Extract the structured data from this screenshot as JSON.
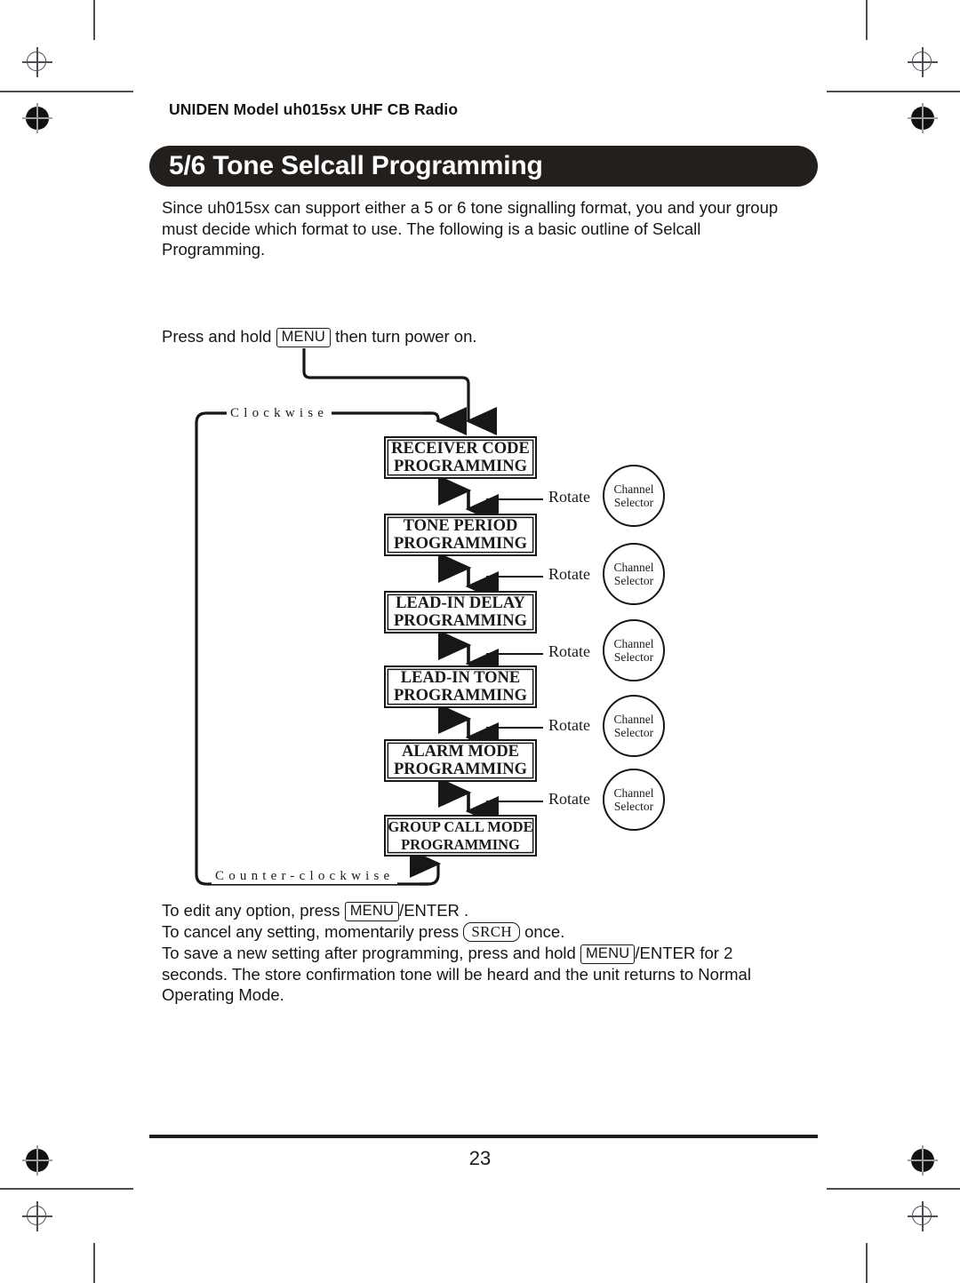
{
  "header": {
    "running_head": "UNIDEN Model uh015sx UHF CB Radio",
    "title": "5/6 Tone Selcall Programming"
  },
  "intro": {
    "paragraph": "Since uh015sx can support either a 5 or 6 tone signalling format, you and your group must decide which format to use. The following is a basic outline of Selcall Programming."
  },
  "press_instruction": {
    "before": "Press and hold",
    "key": "MENU",
    "after": "then turn power on."
  },
  "diagram": {
    "clockwise_label": "Clockwise",
    "counter_clockwise_label": "Counter-clockwise",
    "rotate_label": "Rotate",
    "selector_line1": "Channel",
    "selector_line2": "Selector",
    "steps": [
      {
        "line1": "RECEIVER CODE",
        "line2": "PROGRAMMING"
      },
      {
        "line1": "TONE PERIOD",
        "line2": "PROGRAMMING"
      },
      {
        "line1": "LEAD-IN DELAY",
        "line2": "PROGRAMMING"
      },
      {
        "line1": "LEAD-IN TONE",
        "line2": "PROGRAMMING"
      },
      {
        "line1": "ALARM MODE",
        "line2": "PROGRAMMING"
      },
      {
        "line1": "GROUP CALL MODE",
        "line2": "PROGRAMMING"
      }
    ]
  },
  "notes": {
    "line1_before": "To edit any option, press",
    "line1_key": "MENU",
    "line1_after": "/ENTER .",
    "line2_before": "To cancel any setting, momentarily press",
    "line2_key": "SRCH",
    "line2_after": "once.",
    "line3_before": "To save a new setting after programming, press and hold",
    "line3_key": "MENU",
    "line3_after": "/ENTER for 2 seconds. The store confirmation tone will be heard and the unit returns to Normal Operating Mode."
  },
  "footer": {
    "page_number": "23"
  },
  "colors": {
    "banner_bg": "#231f1d",
    "banner_text": "#ffffff",
    "ink": "#1a1a1a"
  }
}
